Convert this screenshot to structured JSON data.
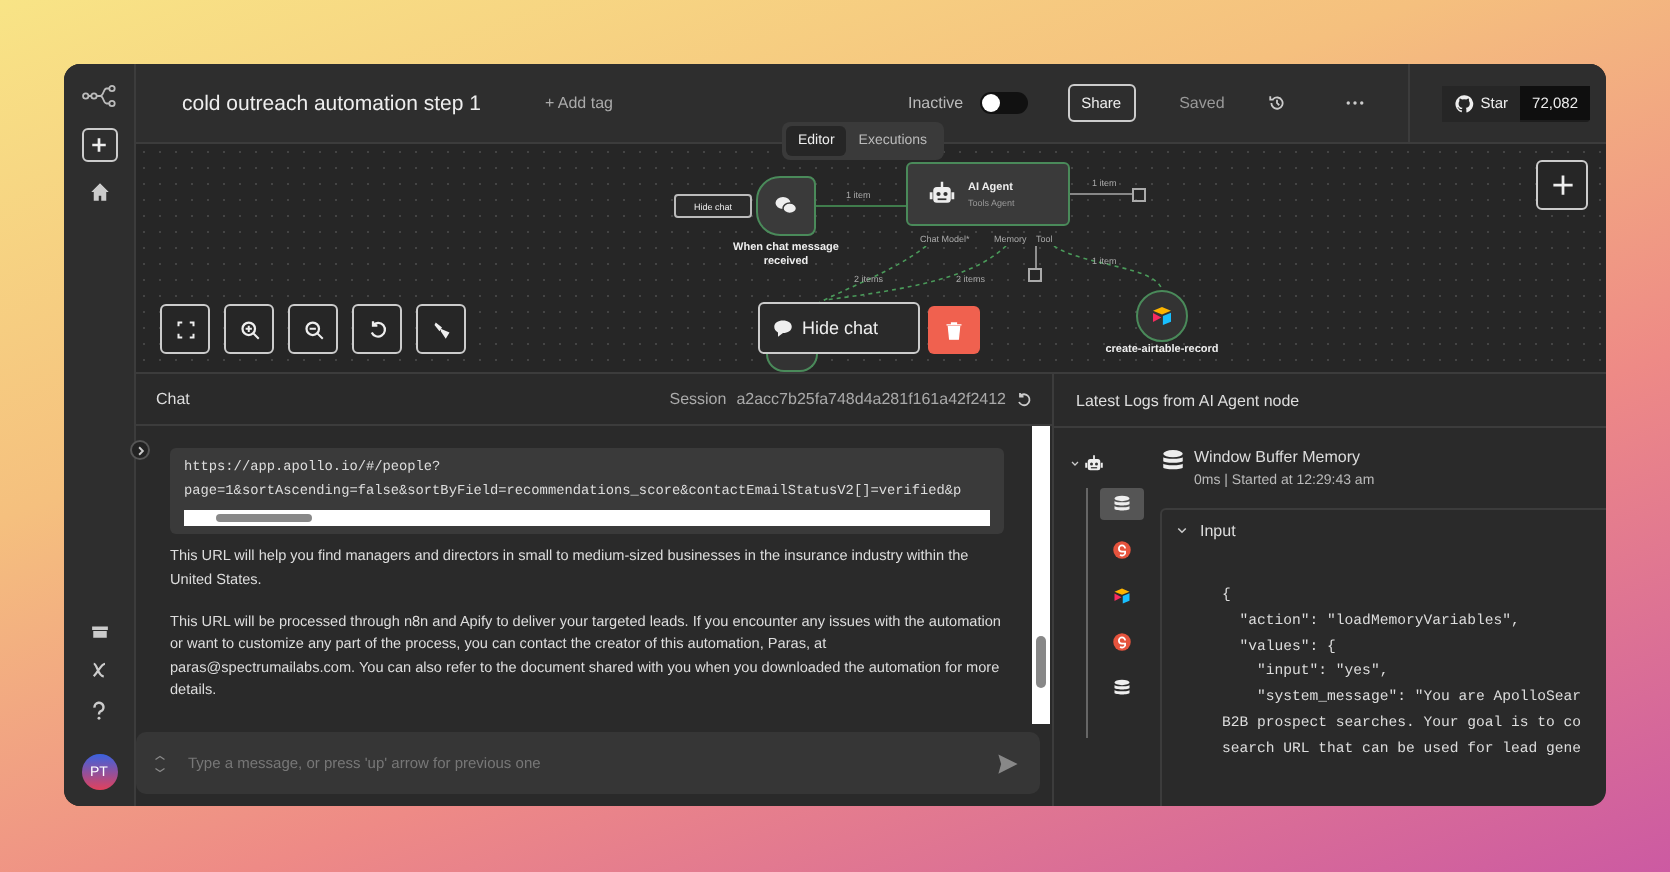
{
  "sidebar": {
    "avatar": "PT"
  },
  "topbar": {
    "title": "cold outreach automation step 1",
    "add_tag": "+ Add tag",
    "status": {
      "label": "Inactive",
      "on": false
    },
    "share": "Share",
    "saved": "Saved",
    "star": {
      "label": "Star",
      "count": "72,082"
    }
  },
  "tabs": [
    {
      "label": "Editor",
      "selected": true
    },
    {
      "label": "Executions",
      "selected": false
    }
  ],
  "canvas": {
    "chat_toggle": "Hide chat",
    "nodes": [
      {
        "kind": "trigger",
        "label": "When chat message received"
      },
      {
        "kind": "agent",
        "label": "AI Agent",
        "subtitle": "Tools Agent",
        "handles": [
          "Chat Model*",
          "Memory",
          "Tool"
        ]
      },
      {
        "kind": "airtable",
        "label": "create-airtable-record"
      },
      {
        "kind": "memory"
      }
    ],
    "edge_labels": [
      "1 item",
      "2 items",
      "1 item",
      "2 items",
      "1 item"
    ],
    "hide_chat": "Hide chat"
  },
  "chat": {
    "title": "Chat",
    "session_label": "Session",
    "session_id": "a2acc7b25fa748d4a281f161a42f2412",
    "code_lines": [
      "https://app.apollo.io/#/people?",
      "page=1&sortAscending=false&sortByField=recommendations_score&contactEmailStatusV2[]=verified&p"
    ],
    "paragraphs": [
      "This URL will help you find managers and directors in small to medium-sized businesses in the insurance industry within the United States.",
      "This URL will be processed through n8n and Apify to deliver your targeted leads. If you encounter any issues with the automation or want to customize any part of the process, you can contact the creator of this automation, Paras, at paras@spectrumailabs.com. You can also refer to the document shared with you when you downloaded the automation for more details."
    ],
    "input": {
      "placeholder": "Type a message, or press 'up' arrow for previous one"
    }
  },
  "logs": {
    "title": "Latest Logs from AI Agent node",
    "tree": {
      "kind": "agent",
      "expanded": true,
      "children": [
        {
          "kind": "memory",
          "selected": true
        },
        {
          "kind": "model",
          "selected": false
        },
        {
          "kind": "airtable",
          "selected": false
        },
        {
          "kind": "model",
          "selected": false
        },
        {
          "kind": "memory",
          "selected": false
        }
      ]
    },
    "detail": {
      "title": "Window Buffer Memory",
      "meta": "0ms | Started at 12:29:43 am",
      "section": {
        "label": "Input",
        "expanded": true
      },
      "code_lines": [
        "{",
        "  \"action\": \"loadMemoryVariables\",",
        "  \"values\": {",
        "    \"input\": \"yes\",",
        "    \"system_message\": \"You are ApolloSear",
        "B2B prospect searches. Your goal is to co",
        "search URL that can be used for lead gene"
      ]
    }
  }
}
